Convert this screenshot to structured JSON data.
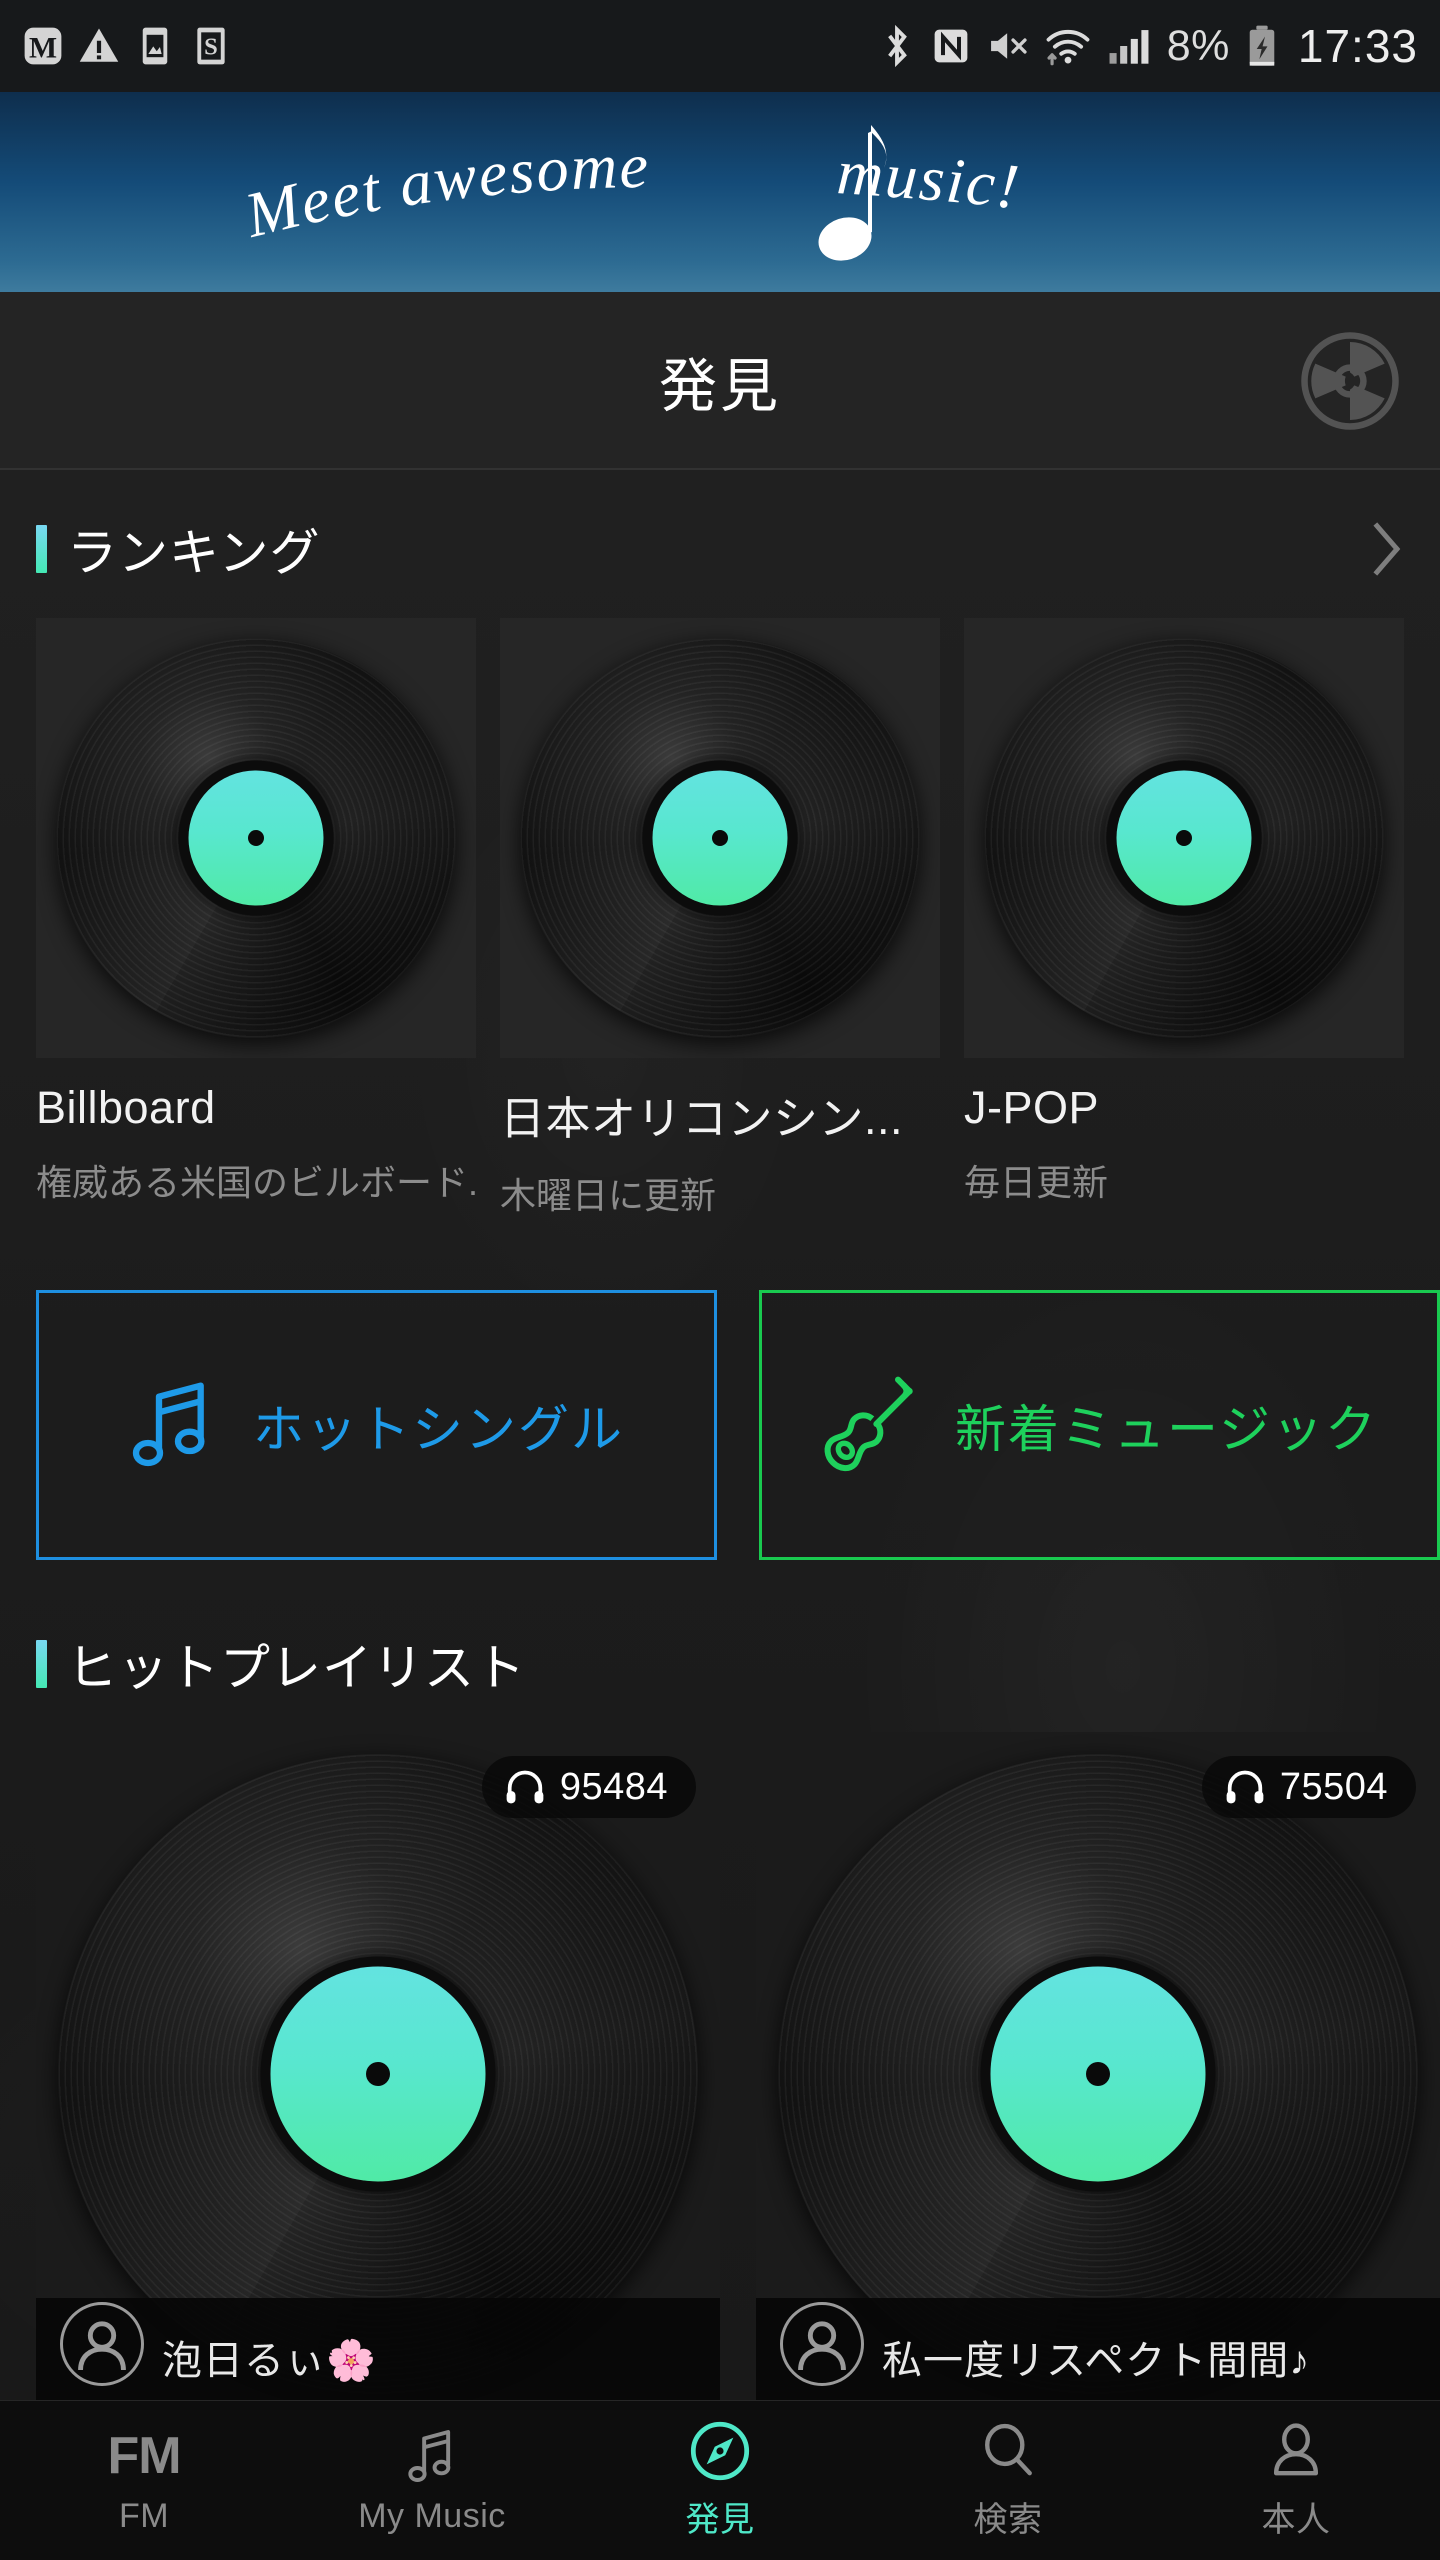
{
  "status_bar": {
    "left_icons": [
      "m-app-icon",
      "warning-triangle-icon",
      "image-gallery-icon",
      "s-app-icon"
    ],
    "right_icons": [
      "bluetooth-icon",
      "nfc-icon",
      "mute-icon",
      "wifi-icon",
      "cellular-signal-icon"
    ],
    "battery_percent": "8%",
    "battery_state": "charging",
    "clock": "17:33"
  },
  "banner": {
    "text": "Meet awesome♪music!",
    "gradient_top": "#0e2e4d",
    "gradient_bottom": "#3e7b9e"
  },
  "header": {
    "title": "発見",
    "disc_icon": "cd-disc-icon"
  },
  "ranking": {
    "section_title": "ランキング",
    "more_icon": "chevron-right-icon",
    "accent_from": "#79d8f2",
    "accent_to": "#44e9b4",
    "cards": [
      {
        "title": "Billboard",
        "subtitle": "権威ある米国のビルボード..."
      },
      {
        "title": "日本オリコンシン...",
        "subtitle": "木曜日に更新"
      },
      {
        "title": "J-POP",
        "subtitle": "毎日更新"
      }
    ]
  },
  "features": [
    {
      "label": "ホットシングル",
      "icon": "beamed-note-icon",
      "color": "#1e9ae8"
    },
    {
      "label": "新着ミュージック",
      "icon": "guitar-icon",
      "color": "#1ed15c"
    }
  ],
  "playlist": {
    "section_title": "ヒットプレイリスト",
    "cards": [
      {
        "count": "95484",
        "icon": "headphones-icon",
        "user": "泡日るぃ🌸",
        "avatar": "user-avatar-icon"
      },
      {
        "count": "75504",
        "icon": "headphones-icon",
        "user": "私一度リスペクト間間♪",
        "avatar": "user-avatar-icon"
      }
    ]
  },
  "bottom_nav": {
    "active_color": "#4fe8c8",
    "inactive_color": "#8a8a8a",
    "items": [
      {
        "label": "FM",
        "icon": "fm-text-icon",
        "active": false
      },
      {
        "label": "My Music",
        "icon": "music-note-icon",
        "active": false
      },
      {
        "label": "発見",
        "icon": "compass-discover-icon",
        "active": true
      },
      {
        "label": "検索",
        "icon": "search-magnifier-icon",
        "active": false
      },
      {
        "label": "本人",
        "icon": "person-profile-icon",
        "active": false
      }
    ]
  }
}
